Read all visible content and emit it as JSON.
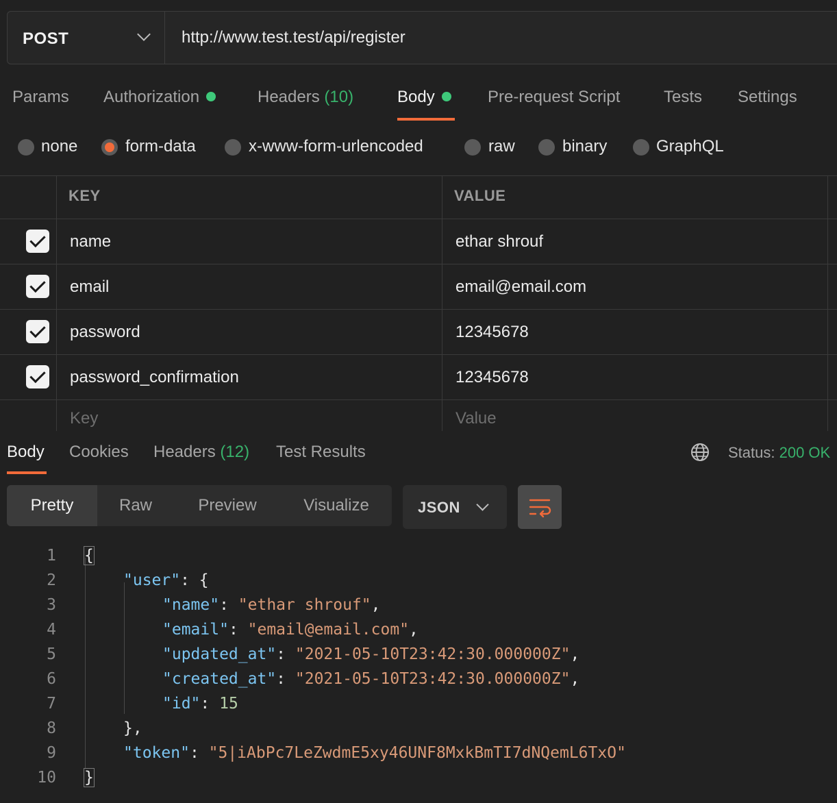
{
  "request": {
    "method": "POST",
    "url": "http://www.test.test/api/register"
  },
  "request_tabs": [
    {
      "label": "Params",
      "active": false
    },
    {
      "label": "Authorization",
      "dot": true,
      "active": false
    },
    {
      "label": "Headers",
      "count": "(10)",
      "active": false
    },
    {
      "label": "Body",
      "dot": true,
      "active": true
    },
    {
      "label": "Pre-request Script",
      "active": false
    },
    {
      "label": "Tests",
      "active": false
    },
    {
      "label": "Settings",
      "active": false
    }
  ],
  "body_types": [
    {
      "label": "none",
      "selected": false
    },
    {
      "label": "form-data",
      "selected": true
    },
    {
      "label": "x-www-form-urlencoded",
      "selected": false
    },
    {
      "label": "raw",
      "selected": false
    },
    {
      "label": "binary",
      "selected": false
    },
    {
      "label": "GraphQL",
      "selected": false
    }
  ],
  "form_table": {
    "key_header": "KEY",
    "value_header": "VALUE",
    "rows": [
      {
        "key": "name",
        "value": "ethar shrouf",
        "checked": true
      },
      {
        "key": "email",
        "value": "email@email.com",
        "checked": true
      },
      {
        "key": "password",
        "value": "12345678",
        "checked": true
      },
      {
        "key": "password_confirmation",
        "value": "12345678",
        "checked": true
      }
    ],
    "key_placeholder": "Key",
    "value_placeholder": "Value"
  },
  "response_tabs": [
    {
      "label": "Body",
      "active": true
    },
    {
      "label": "Cookies",
      "active": false
    },
    {
      "label": "Headers",
      "count": "(12)",
      "active": false
    },
    {
      "label": "Test Results",
      "active": false
    }
  ],
  "status": {
    "label": "Status:",
    "value": "200 OK"
  },
  "view_modes": [
    {
      "label": "Pretty",
      "active": true
    },
    {
      "label": "Raw",
      "active": false
    },
    {
      "label": "Preview",
      "active": false
    },
    {
      "label": "Visualize",
      "active": false
    }
  ],
  "format": "JSON",
  "icons": {
    "method_dropdown": "chevron-down-icon",
    "globe": "globe-icon",
    "wrap": "wrap-lines-icon",
    "format_dropdown": "chevron-down-icon"
  },
  "colors": {
    "accent": "#f26b3a",
    "green": "#38b26b",
    "json_key": "#7cc5f1",
    "json_string": "#d99a78",
    "json_number": "#b5cea8"
  },
  "code_lines": [
    {
      "num": "1",
      "indent": 0,
      "text": "{"
    },
    {
      "num": "2",
      "indent": 1,
      "key": "\"user\"",
      "rest": ": {"
    },
    {
      "num": "3",
      "indent": 2,
      "key": "\"name\"",
      "sep": ": ",
      "str": "\"ethar shrouf\"",
      "end": ","
    },
    {
      "num": "4",
      "indent": 2,
      "key": "\"email\"",
      "sep": ": ",
      "str": "\"email@email.com\"",
      "end": ","
    },
    {
      "num": "5",
      "indent": 2,
      "key": "\"updated_at\"",
      "sep": ": ",
      "str": "\"2021-05-10T23:42:30.000000Z\"",
      "end": ","
    },
    {
      "num": "6",
      "indent": 2,
      "key": "\"created_at\"",
      "sep": ": ",
      "str": "\"2021-05-10T23:42:30.000000Z\"",
      "end": ","
    },
    {
      "num": "7",
      "indent": 2,
      "key": "\"id\"",
      "sep": ": ",
      "numval": "15",
      "end": ""
    },
    {
      "num": "8",
      "indent": 1,
      "text": "},"
    },
    {
      "num": "9",
      "indent": 1,
      "key": "\"token\"",
      "sep": ": ",
      "str": "\"5|iAbPc7LeZwdmE5xy46UNF8MxkBmTI7dNQemL6TxO\"",
      "end": ""
    },
    {
      "num": "10",
      "indent": 0,
      "text": "}"
    }
  ]
}
